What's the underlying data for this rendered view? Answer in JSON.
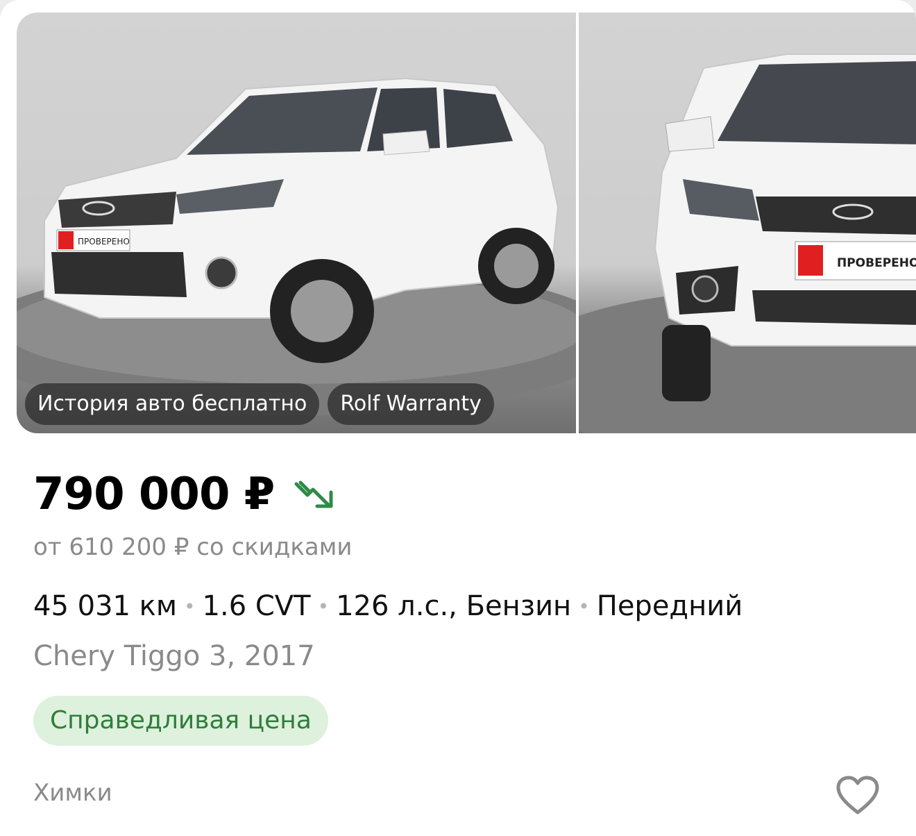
{
  "gallery": {
    "chips": [
      "История авто бесплатно",
      "Rolf Warranty"
    ],
    "plate_text": "ПРОВЕРЕНО"
  },
  "listing": {
    "price": "790 000 ₽",
    "discount_price": "от 610 200 ₽ со скидками",
    "specs": [
      "45 031 км",
      "1.6 CVT",
      "126 л.с., Бензин",
      "Передний"
    ],
    "separator": "•",
    "model": "Chery Tiggo 3, 2017",
    "badge": "Справедливая цена",
    "city": "Химки"
  },
  "colors": {
    "badge_bg": "#ddf1dc",
    "badge_text": "#2f7d3c",
    "trend_green": "#2e8b47"
  },
  "icons": {
    "trend": "trend-down-icon",
    "favorite": "heart-icon"
  }
}
